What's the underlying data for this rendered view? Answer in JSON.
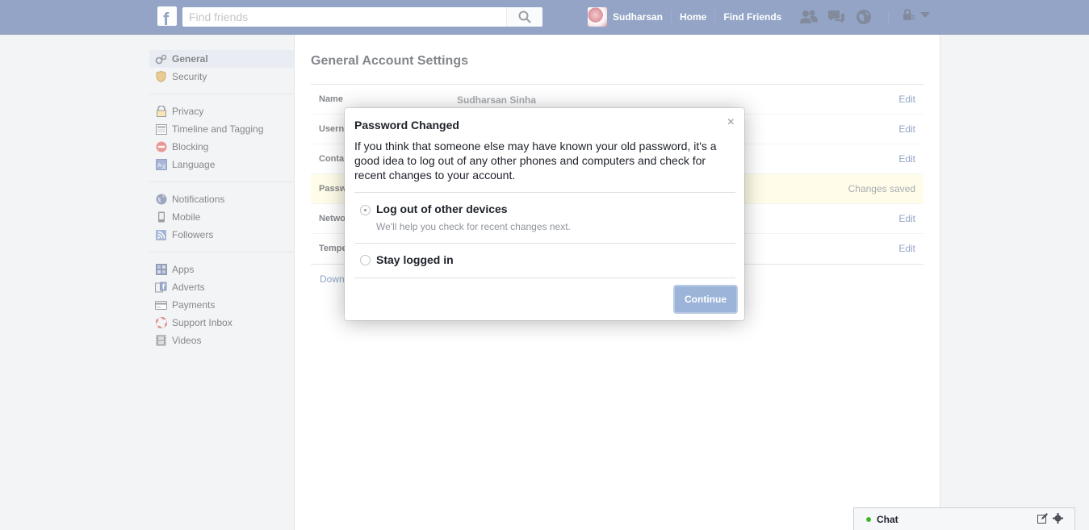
{
  "topbar": {
    "logo": "f",
    "search_placeholder": "Find friends",
    "profile_name": "Sudharsan",
    "home": "Home",
    "find_friends": "Find Friends",
    "icons": [
      "friend-requests-icon",
      "messages-icon",
      "notifications-globe-icon",
      "privacy-lock-icon",
      "account-menu-caret-icon"
    ]
  },
  "leftnav": {
    "group1": [
      {
        "label": "General",
        "icon": "gear-icon",
        "active": true
      },
      {
        "label": "Security",
        "icon": "shield-icon"
      }
    ],
    "group2": [
      {
        "label": "Privacy",
        "icon": "lock-icon"
      },
      {
        "label": "Timeline and Tagging",
        "icon": "timeline-icon"
      },
      {
        "label": "Blocking",
        "icon": "block-icon"
      },
      {
        "label": "Language",
        "icon": "language-icon"
      }
    ],
    "group3": [
      {
        "label": "Notifications",
        "icon": "globe-icon"
      },
      {
        "label": "Mobile",
        "icon": "mobile-icon"
      },
      {
        "label": "Followers",
        "icon": "rss-icon"
      }
    ],
    "group4": [
      {
        "label": "Apps",
        "icon": "apps-icon"
      },
      {
        "label": "Adverts",
        "icon": "adverts-icon"
      },
      {
        "label": "Payments",
        "icon": "card-icon"
      },
      {
        "label": "Support Inbox",
        "icon": "lifebuoy-icon"
      },
      {
        "label": "Videos",
        "icon": "film-icon"
      }
    ]
  },
  "settings": {
    "title": "General Account Settings",
    "rows": [
      {
        "label": "Name",
        "value": "Sudharsan Sinha",
        "action": "Edit"
      },
      {
        "label": "Usern",
        "value": "",
        "action": "Edit"
      },
      {
        "label": "Conta",
        "value": "",
        "action": "Edit"
      },
      {
        "label": "Passw",
        "value": "",
        "status": "Changes saved"
      },
      {
        "label": "Netwo",
        "value": "",
        "action": "Edit"
      },
      {
        "label": "Tempe",
        "value": "",
        "action": "Edit"
      }
    ],
    "download_link": "Down"
  },
  "modal": {
    "title": "Password Changed",
    "close": "×",
    "body": "If you think that someone else may have known your old password, it's a good idea to log out of any other phones and computers and check for recent changes to your account.",
    "option1_label": "Log out of other devices",
    "option1_sub": "We'll help you check for recent changes next.",
    "option1_checked": true,
    "option2_label": "Stay logged in",
    "continue": "Continue"
  },
  "chat": {
    "label": "Chat",
    "status_color": "#42b72a"
  },
  "colors": {
    "brand": "#3b5998",
    "link": "#365899",
    "highlight_row": "#fff9d7",
    "button_disabled": "#9cb4d8"
  }
}
